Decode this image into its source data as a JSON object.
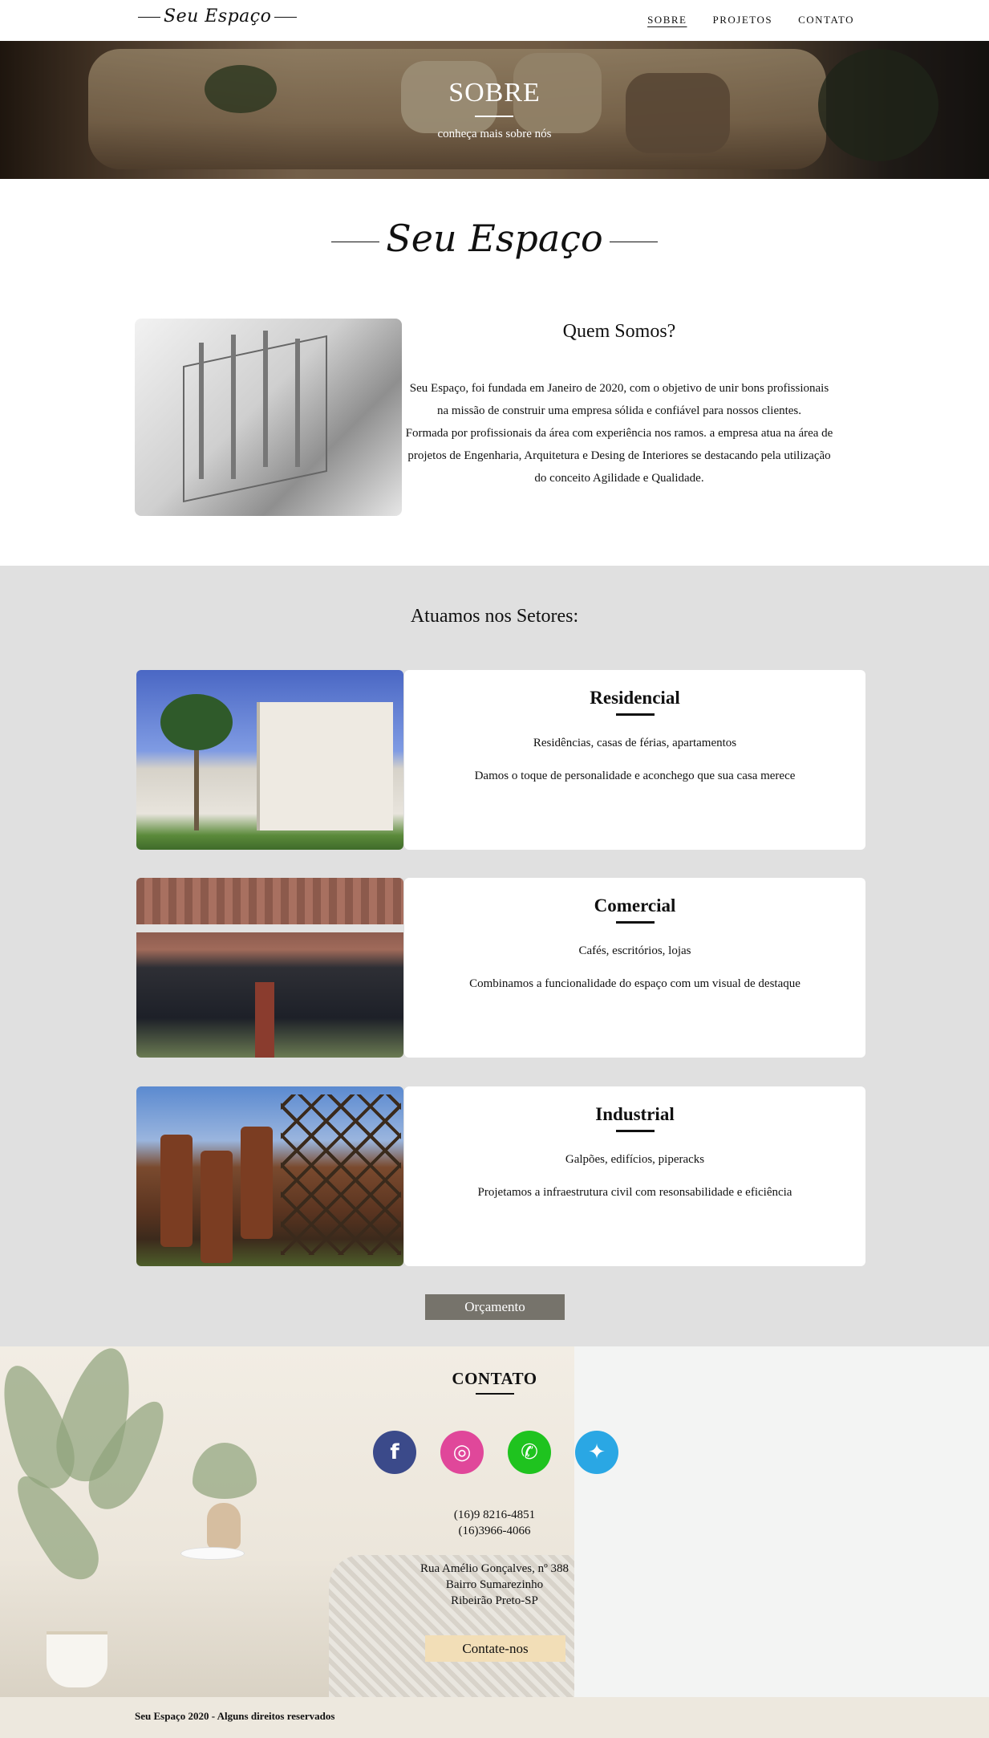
{
  "nav": {
    "brand": "Seu Espaço",
    "items": [
      {
        "label": "SOBRE",
        "active": true
      },
      {
        "label": "PROJETOS",
        "active": false
      },
      {
        "label": "CONTATO",
        "active": false
      }
    ]
  },
  "hero": {
    "title": "SOBRE",
    "subtitle": "conheça mais sobre nós"
  },
  "logo": "Seu Espaço",
  "about": {
    "title": "Quem Somos?",
    "paragraph1": "Seu Espaço, foi fundada em Janeiro de 2020, com o objetivo de unir bons profissionais na missão de construir uma empresa sólida e confiável para nossos clientes.",
    "paragraph2": "Formada por profissionais da área com experiência nos ramos. a empresa atua na área de projetos de Engenharia, Arquitetura e Desing de Interiores se destacando pela utilização do conceito Agilidade e Qualidade."
  },
  "setores": {
    "title": "Atuamos nos Setores:",
    "cards": [
      {
        "title": "Residencial",
        "line1": "Residências, casas de férias, apartamentos",
        "line2": "Damos o toque de personalidade e aconchego que sua casa merece"
      },
      {
        "title": "Comercial",
        "line1": "Cafés, escritórios, lojas",
        "line2": "Combinamos a funcionalidade do espaço com um visual de destaque"
      },
      {
        "title": "Industrial",
        "line1": "Galpões, edifícios, piperacks",
        "line2": "Projetamos a infraestrutura civil com resonsabilidade e eficiência"
      }
    ],
    "button": "Orçamento"
  },
  "contato": {
    "title": "CONTATO",
    "socials": [
      {
        "icon": "facebook-icon",
        "glyph": "f",
        "color": "#3b4a8a"
      },
      {
        "icon": "instagram-icon",
        "glyph": "◎",
        "color": "#e0479a"
      },
      {
        "icon": "whatsapp-icon",
        "glyph": "✆",
        "color": "#1fc31f"
      },
      {
        "icon": "twitter-icon",
        "glyph": "✦",
        "color": "#2aa7e4"
      }
    ],
    "phone1": "(16)9 8216-4851",
    "phone2": "(16)3966-4066",
    "address1": "Rua Amélio Gonçalves, nº 388",
    "address2": "Bairro Sumarezinho",
    "address3": "Ribeirão Preto-SP",
    "button": "Contate-nos"
  },
  "footer": {
    "text": "Seu Espaço 2020 - Alguns direitos reservados"
  }
}
